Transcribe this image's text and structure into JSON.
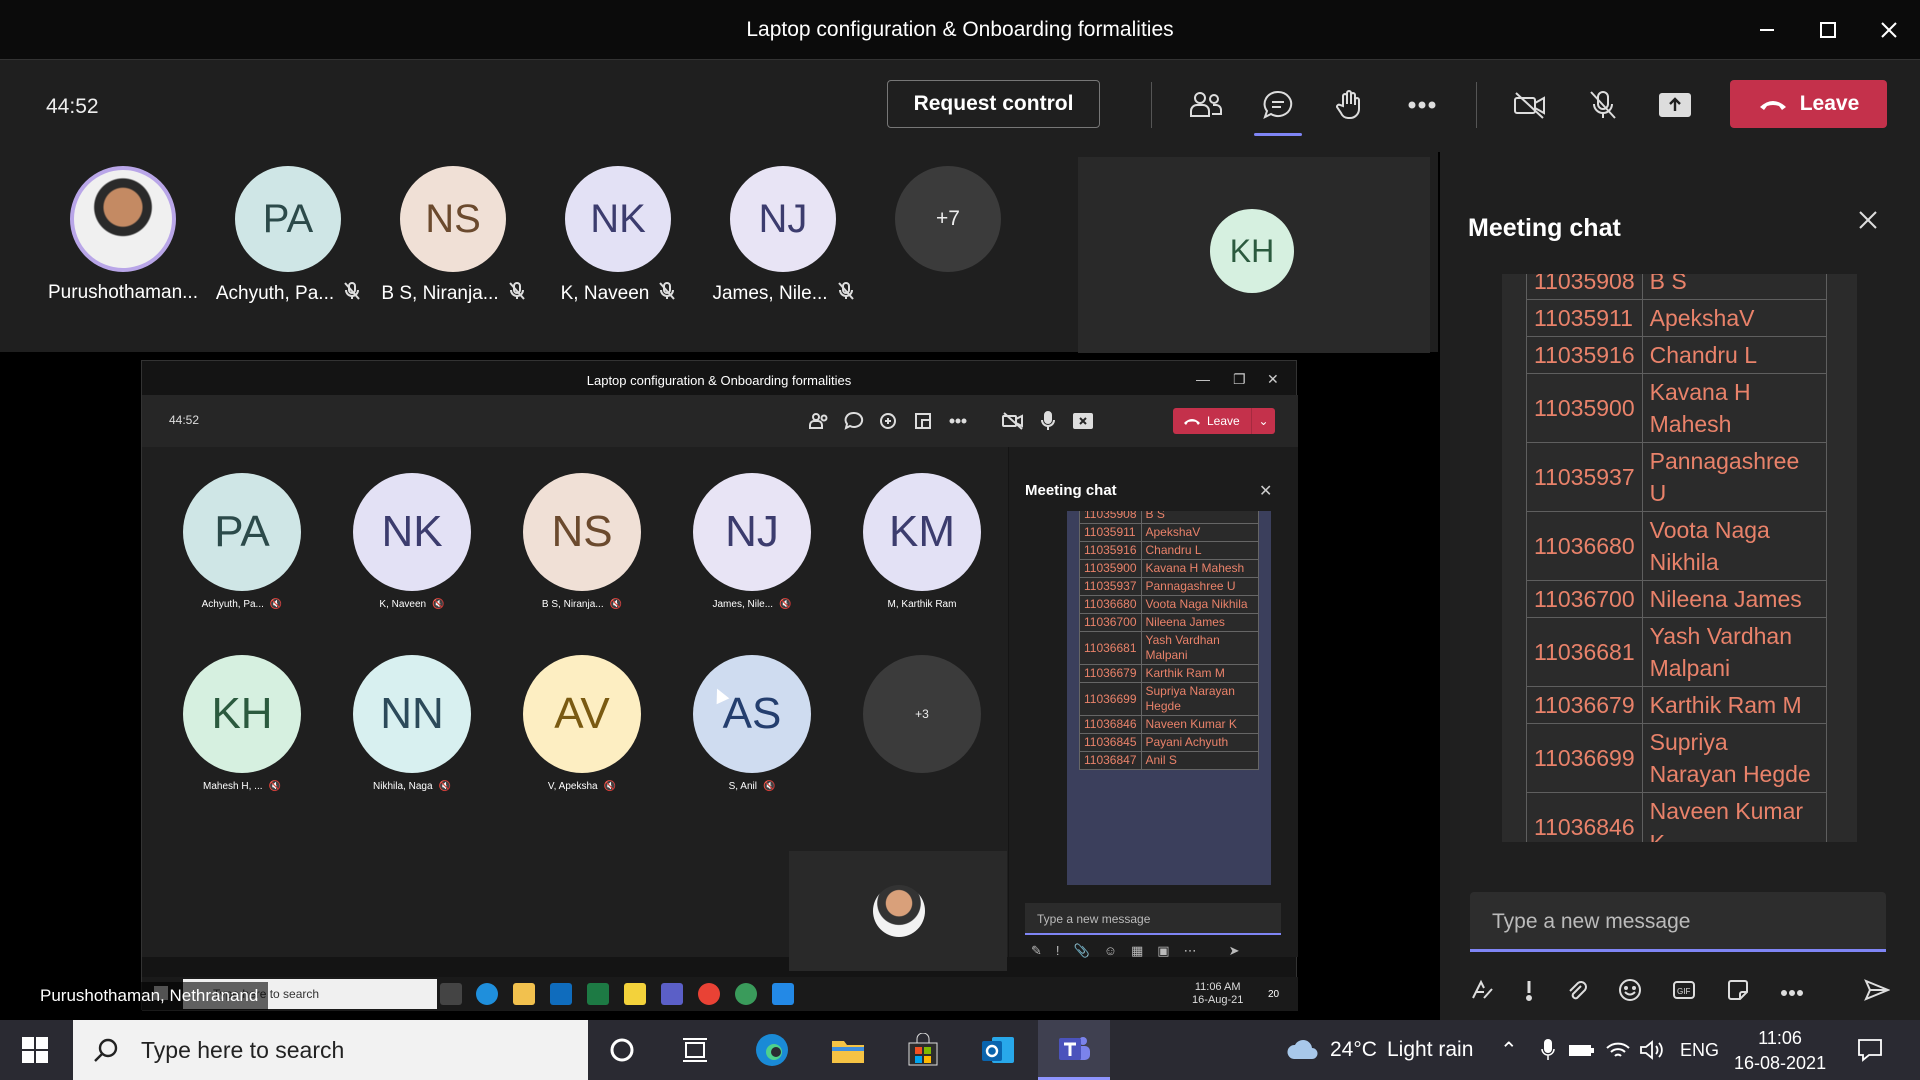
{
  "window": {
    "title": "Laptop configuration & Onboarding formalities"
  },
  "toolbar": {
    "timer": "44:52",
    "request_control": "Request control",
    "leave": "Leave",
    "icons": [
      "people-icon",
      "chat-icon",
      "raise-hand-icon",
      "more-icon",
      "camera-off-icon",
      "mic-off-icon",
      "share-icon"
    ]
  },
  "participants": [
    {
      "initials": "",
      "name": "Purushothaman...",
      "muted": false,
      "color": "#b9a6e8",
      "photo": true
    },
    {
      "initials": "PA",
      "name": "Achyuth, Pa...",
      "muted": true,
      "color": "#cfe6e6",
      "text": "#2c4a4a"
    },
    {
      "initials": "NS",
      "name": "B S, Niranja...",
      "muted": true,
      "color": "#f0e0d6",
      "text": "#6b4a2e"
    },
    {
      "initials": "NK",
      "name": "K, Naveen",
      "muted": true,
      "color": "#e3e1f5",
      "text": "#3c3c6e"
    },
    {
      "initials": "NJ",
      "name": "James, Nile...",
      "muted": true,
      "color": "#e8e4f5",
      "text": "#3c3c6e"
    }
  ],
  "overflow_count": "+7",
  "spotlight": {
    "initials": "KH",
    "color": "#d6f0e0",
    "text": "#2b5a3e"
  },
  "presenter_name": "Purushothaman, Nethranand",
  "shared": {
    "title": "Laptop configuration & Onboarding formalities",
    "timer": "44:52",
    "leave": "Leave",
    "participants": [
      {
        "initials": "PA",
        "name": "Achyuth, Pa...",
        "muted": true,
        "color": "#cfe6e6",
        "text": "#2c4a4a"
      },
      {
        "initials": "NK",
        "name": "K, Naveen",
        "muted": true,
        "color": "#e3e1f5",
        "text": "#3c3c6e"
      },
      {
        "initials": "NS",
        "name": "B S, Niranja...",
        "muted": true,
        "color": "#f0e0d6",
        "text": "#6b4a2e"
      },
      {
        "initials": "NJ",
        "name": "James, Nile...",
        "muted": true,
        "color": "#e8e4f5",
        "text": "#3c3c6e"
      },
      {
        "initials": "KM",
        "name": "M, Karthik Ram",
        "muted": false,
        "color": "#e3e1f5",
        "text": "#3c3c6e"
      },
      {
        "initials": "KH",
        "name": "Mahesh H, ...",
        "muted": true,
        "color": "#d6f0e0",
        "text": "#2b5a3e"
      },
      {
        "initials": "NN",
        "name": "Nikhila, Naga",
        "muted": true,
        "color": "#d8f0f0",
        "text": "#2c4a5a"
      },
      {
        "initials": "AV",
        "name": "V, Apeksha",
        "muted": true,
        "color": "#fdeec2",
        "text": "#7a5a12"
      },
      {
        "initials": "AS",
        "name": "S, Anil",
        "muted": true,
        "color": "#cfdcf0",
        "text": "#243e6e"
      }
    ],
    "overflow_count": "+3",
    "chat_title": "Meeting chat",
    "message_placeholder": "Type a new message",
    "search_placeholder": "Type here to search",
    "clock_time": "11:06 AM",
    "clock_date": "16-Aug-21",
    "notif_count": "20"
  },
  "chat": {
    "title": "Meeting chat",
    "placeholder": "Type a new message",
    "rows": [
      {
        "id": "11035908",
        "name": "B S"
      },
      {
        "id": "11035911",
        "name": "ApekshaV"
      },
      {
        "id": "11035916",
        "name": "Chandru L"
      },
      {
        "id": "11035900",
        "name": "Kavana H Mahesh"
      },
      {
        "id": "11035937",
        "name": "Pannagashree U"
      },
      {
        "id": "11036680",
        "name": "Voota Naga Nikhila"
      },
      {
        "id": "11036700",
        "name": "Nileena James"
      },
      {
        "id": "11036681",
        "name": "Yash Vardhan Malpani"
      },
      {
        "id": "11036679",
        "name": "Karthik Ram M"
      },
      {
        "id": "11036699",
        "name": "Supriya Narayan Hegde"
      },
      {
        "id": "11036846",
        "name": "Naveen Kumar K"
      },
      {
        "id": "11036845",
        "name": "Payani Achyuth"
      },
      {
        "id": "11036847",
        "name": "Anil S"
      }
    ],
    "tools": [
      "format-icon",
      "important-icon",
      "attach-icon",
      "emoji-icon",
      "gif-icon",
      "sticker-icon",
      "more-icon",
      "send-icon"
    ]
  },
  "taskbar": {
    "search_placeholder": "Type here to search",
    "weather_temp": "24°C",
    "weather_text": "Light rain",
    "language": "ENG",
    "time": "11:06",
    "date": "16-08-2021"
  }
}
